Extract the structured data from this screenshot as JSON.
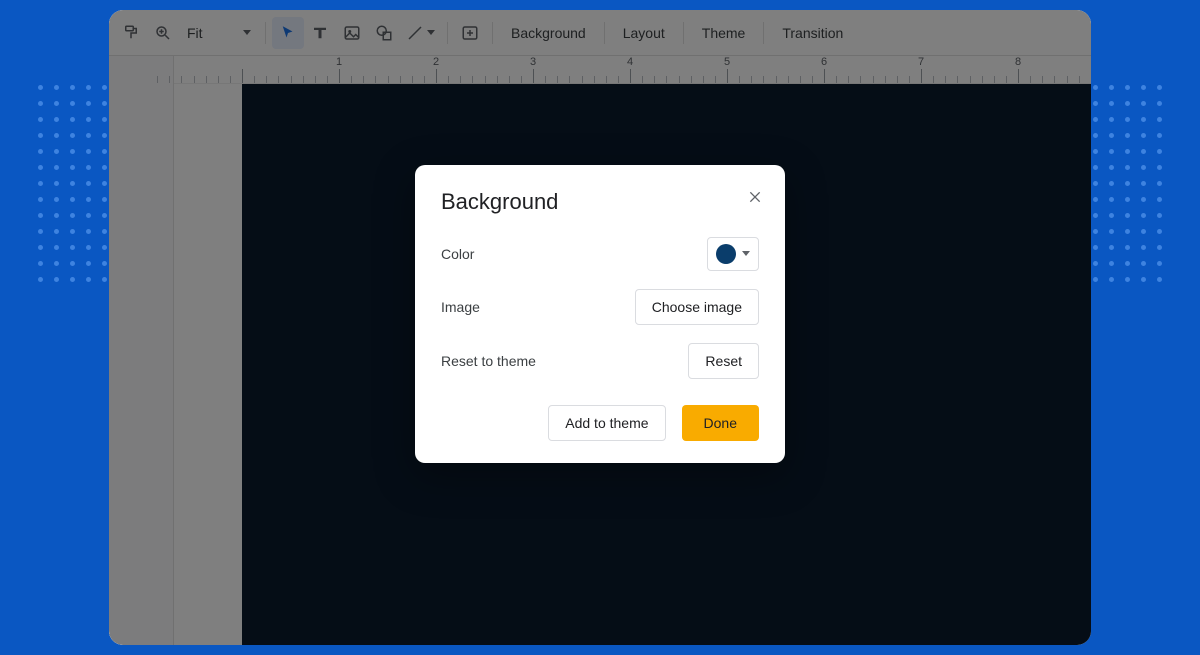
{
  "toolbar": {
    "zoom_label": "Fit",
    "menus": {
      "background": "Background",
      "layout": "Layout",
      "theme": "Theme",
      "transition": "Transition"
    }
  },
  "ruler": {
    "labels": [
      "1",
      "2",
      "3",
      "4",
      "5",
      "6",
      "7",
      "8"
    ],
    "major_spacing_px": 97,
    "minor_per_major": 8
  },
  "slide": {
    "bg_color": "#0a1b2d"
  },
  "dialog": {
    "title": "Background",
    "rows": {
      "color_label": "Color",
      "image_label": "Image",
      "image_button": "Choose image",
      "reset_label": "Reset to theme",
      "reset_button": "Reset"
    },
    "color_value": "#0a3d6b",
    "actions": {
      "add_to_theme": "Add to theme",
      "done": "Done"
    }
  }
}
